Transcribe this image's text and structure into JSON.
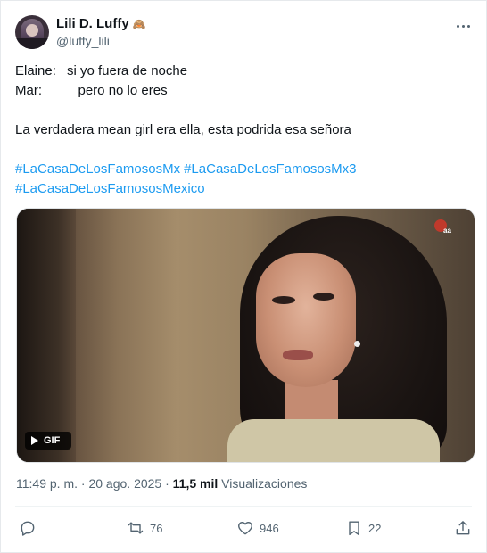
{
  "author": {
    "name": "Lili D. Luffy",
    "emoji": "🙈",
    "handle": "@luffy_lili"
  },
  "post": {
    "lines": [
      {
        "speaker": "Elaine:",
        "text": "si yo fuera de noche"
      },
      {
        "speaker": "Mar:",
        "text": "   pero no lo eres"
      }
    ],
    "comment": "La verdadera mean girl era ella, esta podrida esa señora",
    "hashtags": [
      "#LaCasaDeLosFamososMx",
      "#LaCasaDeLosFamososMx3",
      "#LaCasaDeLosFamososMexico"
    ]
  },
  "media": {
    "gif_label": "GIF",
    "watermark": "aa"
  },
  "meta": {
    "time": "11:49 p. m.",
    "separator": " · ",
    "date": "20 ago. 2025",
    "views_count": "11,5 mil",
    "views_label": "Visualizaciones"
  },
  "actions": {
    "reply_count": "",
    "retweets": "76",
    "likes": "946",
    "bookmarks": "22"
  },
  "icons": {
    "more": "more-dots-icon",
    "reply": "reply-bubble-icon",
    "retweet": "retweet-arrows-icon",
    "like": "heart-icon",
    "bookmark": "bookmark-icon",
    "share": "share-upload-icon",
    "play": "play-icon"
  },
  "colors": {
    "link": "#1d9bf0",
    "muted": "#536471",
    "text": "#0f1419"
  }
}
